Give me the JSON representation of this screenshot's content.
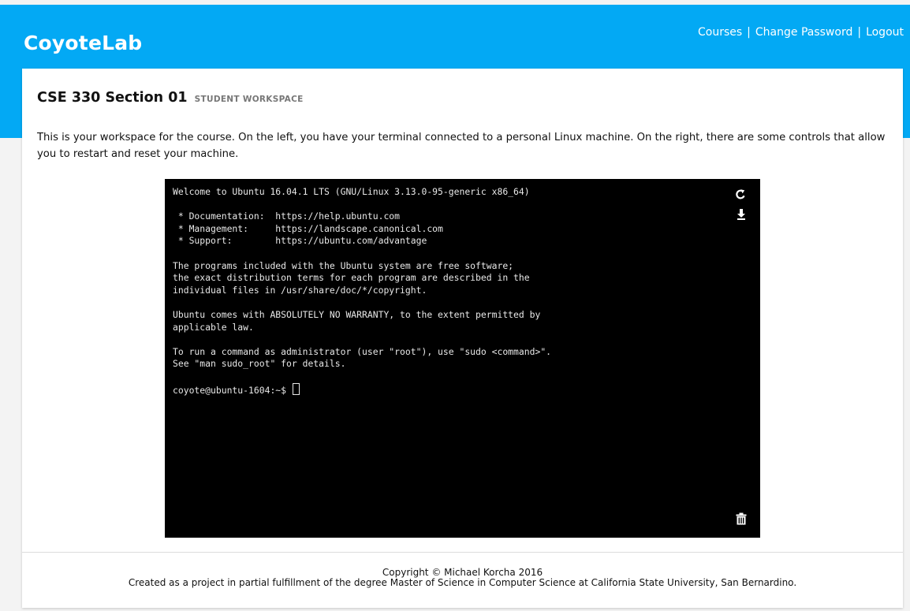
{
  "header": {
    "brand": "CoyoteLab",
    "nav": {
      "courses": "Courses",
      "change_password": "Change Password",
      "logout": "Logout",
      "separator": "|"
    },
    "color": "#03a9f4"
  },
  "course": {
    "title": "CSE 330 Section 01",
    "subtitle": "STUDENT WORKSPACE"
  },
  "intro": "This is your workspace for the course. On the left, you have your terminal connected to a personal Linux machine. On the right, there are some controls that allow you to restart and reset your machine.",
  "terminal": {
    "lines": [
      "Welcome to Ubuntu 16.04.1 LTS (GNU/Linux 3.13.0-95-generic x86_64)",
      "",
      " * Documentation:  https://help.ubuntu.com",
      " * Management:     https://landscape.canonical.com",
      " * Support:        https://ubuntu.com/advantage",
      "",
      "The programs included with the Ubuntu system are free software;",
      "the exact distribution terms for each program are described in the",
      "individual files in /usr/share/doc/*/copyright.",
      "",
      "Ubuntu comes with ABSOLUTELY NO WARRANTY, to the extent permitted by",
      "applicable law.",
      "",
      "To run a command as administrator (user \"root\"), use \"sudo <command>\".",
      "See \"man sudo_root\" for details.",
      ""
    ],
    "prompt": "coyote@ubuntu-1604:~$ ",
    "icons": [
      "restart-icon",
      "download-icon",
      "trash-icon"
    ]
  },
  "footer": {
    "copyright": "Copyright © Michael Korcha 2016",
    "note": "Created as a project in partial fulfillment of the degree Master of Science in Computer Science at California State University, San Bernardino."
  }
}
